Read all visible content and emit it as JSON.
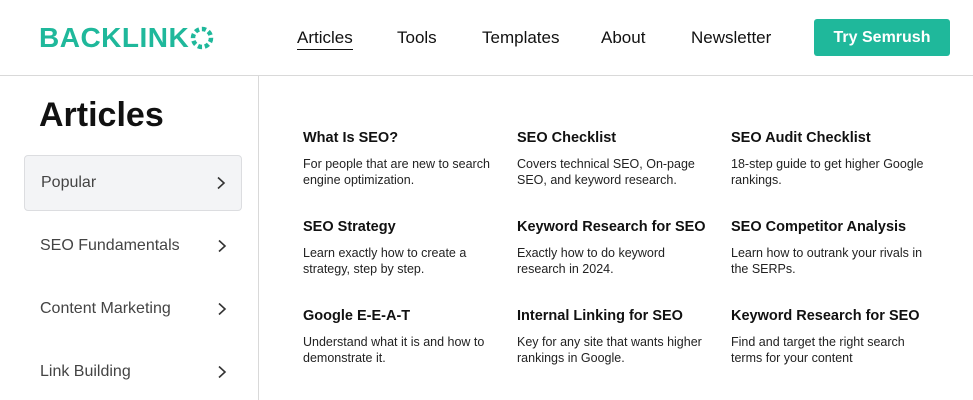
{
  "brand": {
    "name": "BACKLINK",
    "accent": "#1fb89b"
  },
  "nav": {
    "items": [
      {
        "label": "Articles",
        "active": true
      },
      {
        "label": "Tools"
      },
      {
        "label": "Templates"
      },
      {
        "label": "About"
      },
      {
        "label": "Newsletter"
      }
    ],
    "cta_label": "Try Semrush"
  },
  "sidebar": {
    "title": "Articles",
    "items": [
      {
        "label": "Popular",
        "active": true,
        "icon": "chevron-right-icon"
      },
      {
        "label": "SEO Fundamentals",
        "icon": "chevron-right-icon"
      },
      {
        "label": "Content Marketing",
        "icon": "chevron-right-icon"
      },
      {
        "label": "Link Building",
        "icon": "chevron-right-icon"
      }
    ]
  },
  "articles": [
    {
      "title": "What Is SEO?",
      "desc": "For people that are new to search engine optimization."
    },
    {
      "title": "SEO Checklist",
      "desc": "Covers technical SEO, On-page SEO, and keyword research."
    },
    {
      "title": "SEO Audit Checklist",
      "desc": "18-step guide to get higher Google rankings."
    },
    {
      "title": "SEO Strategy",
      "desc": "Learn exactly how to create a strategy, step by step."
    },
    {
      "title": "Keyword Research for SEO",
      "desc": "Exactly how to do keyword research in 2024."
    },
    {
      "title": "SEO Competitor Analysis",
      "desc": "Learn how to outrank your rivals in the SERPs."
    },
    {
      "title": "Google E-E-A-T",
      "desc": "Understand what it is and how to demonstrate it."
    },
    {
      "title": "Internal Linking for SEO",
      "desc": "Key for any site that wants higher rankings in Google."
    },
    {
      "title": "Keyword Research for SEO",
      "desc": "Find and target the right search terms for your content"
    }
  ]
}
